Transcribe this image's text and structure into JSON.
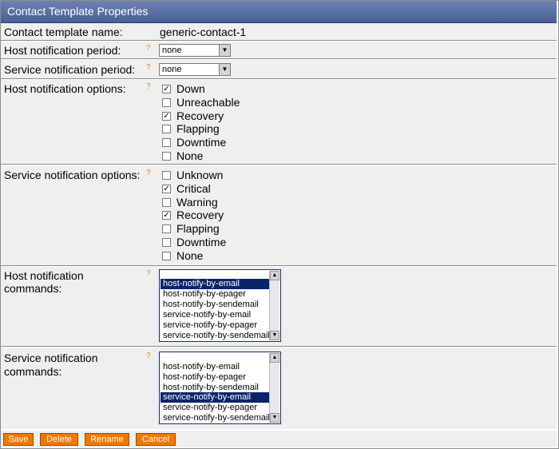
{
  "window": {
    "title": "Contact Template Properties"
  },
  "fields": {
    "name": {
      "label": "Contact template name:",
      "value": "generic-contact-1"
    },
    "host_period": {
      "label": "Host notification period:",
      "value": "none"
    },
    "service_period": {
      "label": "Service notification period:",
      "value": "none"
    },
    "host_options": {
      "label": "Host notification options:",
      "items": [
        {
          "label": "Down",
          "checked": true
        },
        {
          "label": "Unreachable",
          "checked": false
        },
        {
          "label": "Recovery",
          "checked": true
        },
        {
          "label": "Flapping",
          "checked": false
        },
        {
          "label": "Downtime",
          "checked": false
        },
        {
          "label": "None",
          "checked": false
        }
      ]
    },
    "service_options": {
      "label": "Service notification options:",
      "items": [
        {
          "label": "Unknown",
          "checked": false
        },
        {
          "label": "Critical",
          "checked": true
        },
        {
          "label": "Warning",
          "checked": false
        },
        {
          "label": "Recovery",
          "checked": true
        },
        {
          "label": "Flapping",
          "checked": false
        },
        {
          "label": "Downtime",
          "checked": false
        },
        {
          "label": "None",
          "checked": false
        }
      ]
    },
    "host_commands": {
      "label_line1": "Host notification",
      "label_line2": "commands:",
      "items": [
        "",
        "host-notify-by-email",
        "host-notify-by-epager",
        "host-notify-by-sendemail",
        "service-notify-by-email",
        "service-notify-by-epager",
        "service-notify-by-sendemail"
      ],
      "selected": "host-notify-by-email"
    },
    "service_commands": {
      "label_line1": "Service notification",
      "label_line2": "commands:",
      "items": [
        "",
        "host-notify-by-email",
        "host-notify-by-epager",
        "host-notify-by-sendemail",
        "service-notify-by-email",
        "service-notify-by-epager",
        "service-notify-by-sendemail"
      ],
      "selected": "service-notify-by-email"
    }
  },
  "help_glyph": "?",
  "buttons": {
    "save": "Save",
    "delete": "Delete",
    "rename": "Rename",
    "cancel": "Cancel"
  },
  "colors": {
    "title_bar": "#5a6fa3",
    "row_bg": "#efefef",
    "help": "#f08c00",
    "button": "#f07800",
    "selection": "#0a246a"
  }
}
